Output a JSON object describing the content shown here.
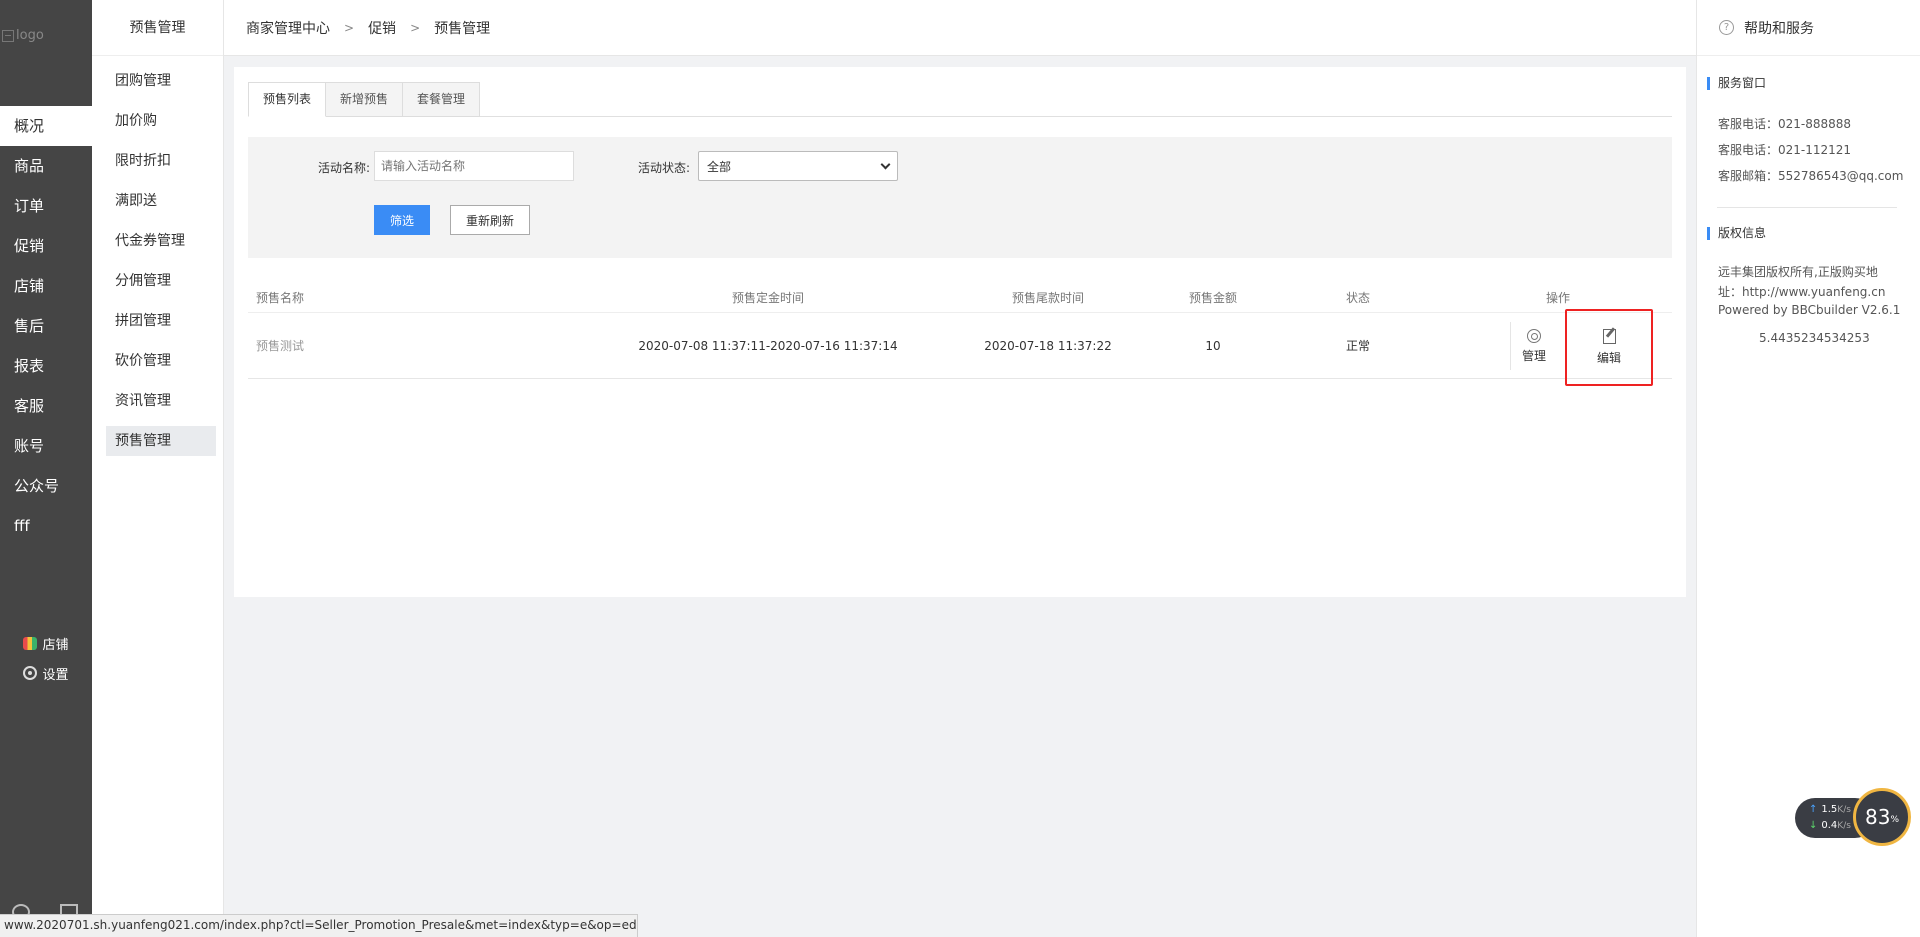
{
  "leftnav": {
    "logo_alt": "logo",
    "items": [
      {
        "label": "概况"
      },
      {
        "label": "商品"
      },
      {
        "label": "订单"
      },
      {
        "label": "促销"
      },
      {
        "label": "店铺"
      },
      {
        "label": "售后"
      },
      {
        "label": "报表"
      },
      {
        "label": "客服"
      },
      {
        "label": "账号"
      },
      {
        "label": "公众号"
      },
      {
        "label": "fff"
      }
    ],
    "shop_label": "店铺",
    "settings_label": "设置"
  },
  "subnav": {
    "title": "预售管理",
    "items": [
      {
        "label": "团购管理"
      },
      {
        "label": "加价购"
      },
      {
        "label": "限时折扣"
      },
      {
        "label": "满即送"
      },
      {
        "label": "代金券管理"
      },
      {
        "label": "分佣管理"
      },
      {
        "label": "拼团管理"
      },
      {
        "label": "砍价管理"
      },
      {
        "label": "资讯管理"
      },
      {
        "label": "预售管理"
      }
    ]
  },
  "breadcrumb": {
    "items": [
      "商家管理中心",
      "促销",
      "预售管理"
    ],
    "separator": ">"
  },
  "tabs": [
    {
      "label": "预售列表"
    },
    {
      "label": "新增预售"
    },
    {
      "label": "套餐管理"
    }
  ],
  "filter": {
    "name_label": "活动名称:",
    "name_placeholder": "请输入活动名称",
    "status_label": "活动状态:",
    "status_value": "全部",
    "filter_button": "筛选",
    "refresh_button": "重新刷新"
  },
  "table": {
    "headers": [
      "预售名称",
      "预售定金时间",
      "预售尾款时间",
      "预售金额",
      "状态",
      "操作"
    ],
    "rows": [
      {
        "name": "预售测试",
        "deposit_time": "2020-07-08 11:37:11-2020-07-16 11:37:14",
        "final_time": "2020-07-18 11:37:22",
        "amount": "10",
        "status": "正常",
        "manage": "管理",
        "edit": "编辑"
      }
    ]
  },
  "help": {
    "title": "帮助和服务",
    "service_title": "服务窗口",
    "phone1": "客服电话：021-888888",
    "phone2": "客服电话：021-112121",
    "email": "客服邮箱：552786543@qq.com",
    "copyright_title": "版权信息",
    "copyright_line1": "远丰集团版权所有,正版购买地",
    "copyright_line2": "址：http://www.yuanfeng.cn",
    "copyright_line3": "Powered by BBCbuilder V2.6.1",
    "version": "5.4435234534253"
  },
  "speed_widget": {
    "up": "1.5",
    "down": "0.4",
    "unit": "K/s",
    "percent": "83",
    "percent_sign": "%"
  },
  "statusbar": {
    "url": "www.2020701.sh.yuanfeng021.com/index.php?ctl=Seller_Promotion_Presale&met=index&typ=e&op=edit..."
  }
}
